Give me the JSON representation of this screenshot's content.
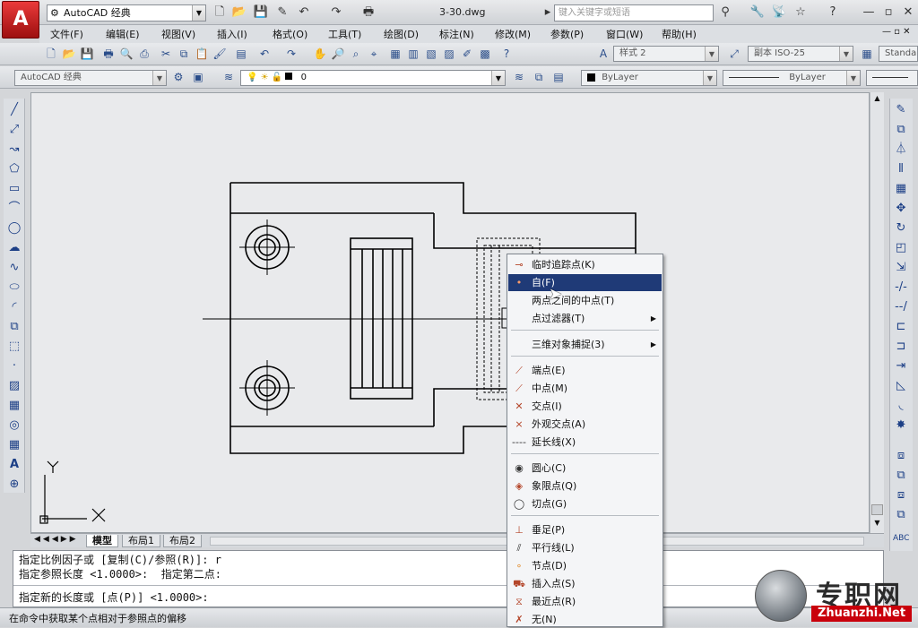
{
  "window": {
    "workspace": "AutoCAD 经典",
    "doc_title": "3-30.dwg",
    "search_placeholder": "键入关键字或短语",
    "app_letter": "A",
    "controls": [
      "—",
      "▫",
      "✕"
    ]
  },
  "menu": [
    "文件(F)",
    "编辑(E)",
    "视图(V)",
    "插入(I)",
    "格式(O)",
    "工具(T)",
    "绘图(D)",
    "标注(N)",
    "修改(M)",
    "参数(P)",
    "窗口(W)",
    "帮助(H)"
  ],
  "toolbar": {
    "textstyle": "样式 2",
    "dimstyle": "副本 ISO-25",
    "tablestyle": "Standa",
    "workspace2": "AutoCAD 经典",
    "layer": "0",
    "color": "ByLayer",
    "linetype": "ByLayer"
  },
  "tabs": [
    "模型",
    "布局1",
    "布局2"
  ],
  "ucs": {
    "y": "Y",
    "x": "X"
  },
  "command": {
    "line1": "指定比例因子或 [复制(C)/参照(R)]: r",
    "line2": "指定参照长度 <1.0000>:  指定第二点:",
    "line3": "指定新的长度或 [点(P)] <1.0000>:"
  },
  "status": "在命令中获取某个点相对于参照点的偏移",
  "context_menu": {
    "items": [
      {
        "label": "临时追踪点(K)",
        "icon": "tracking-icon"
      },
      {
        "label": "自(F)",
        "icon": "from-icon",
        "highlighted": true
      },
      {
        "label": "两点之间的中点(T)",
        "icon": "midbetween-icon"
      },
      {
        "label": "点过滤器(T)",
        "icon": "filter-icon",
        "submenu": true
      },
      {
        "label": "三维对象捕捉(3)",
        "icon": "3dsnap-icon",
        "submenu": true
      },
      {
        "label": "端点(E)",
        "icon": "endpoint-icon"
      },
      {
        "label": "中点(M)",
        "icon": "midpoint-icon"
      },
      {
        "label": "交点(I)",
        "icon": "intersection-icon"
      },
      {
        "label": "外观交点(A)",
        "icon": "apparent-intersection-icon"
      },
      {
        "label": "延长线(X)",
        "icon": "extension-icon"
      },
      {
        "label": "圆心(C)",
        "icon": "center-icon"
      },
      {
        "label": "象限点(Q)",
        "icon": "quadrant-icon"
      },
      {
        "label": "切点(G)",
        "icon": "tangent-icon"
      },
      {
        "label": "垂足(P)",
        "icon": "perpendicular-icon"
      },
      {
        "label": "平行线(L)",
        "icon": "parallel-icon"
      },
      {
        "label": "节点(D)",
        "icon": "node-icon"
      },
      {
        "label": "插入点(S)",
        "icon": "insert-icon"
      },
      {
        "label": "最近点(R)",
        "icon": "nearest-icon"
      },
      {
        "label": "无(N)",
        "icon": "none-icon"
      }
    ]
  },
  "watermark": {
    "text": "专职网",
    "url": "Zhuanzhi.Net"
  }
}
